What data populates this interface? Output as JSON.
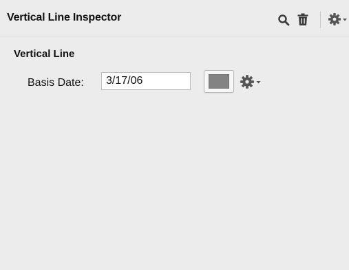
{
  "window": {
    "title": "Vertical Line Inspector"
  },
  "header": {
    "icons": [
      "search-icon",
      "trash-icon",
      "gear-icon",
      "chevron-down-icon"
    ]
  },
  "section": {
    "title": "Vertical Line"
  },
  "basis_date": {
    "label": "Basis Date:",
    "value": "3/17/06"
  },
  "color": {
    "swatch": "#838383"
  }
}
